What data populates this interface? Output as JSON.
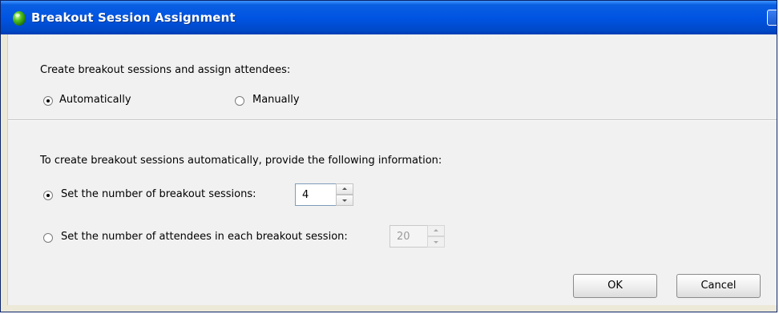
{
  "window": {
    "title": "Breakout Session Assignment"
  },
  "section_create": {
    "prompt": "Create breakout sessions and assign attendees:",
    "options": [
      {
        "label": "Automatically",
        "selected": true
      },
      {
        "label": "Manually",
        "selected": false
      }
    ]
  },
  "section_auto": {
    "prompt": "To create breakout sessions automatically, provide the following information:",
    "number_of_sessions": {
      "label": "Set the number of breakout sessions:",
      "selected": true,
      "value": "4"
    },
    "attendees_per_session": {
      "label": "Set the number of attendees in each breakout session:",
      "selected": false,
      "value": "20",
      "disabled": true
    }
  },
  "buttons": {
    "ok": "OK",
    "cancel": "Cancel"
  },
  "colors": {
    "titlebar": "#0054e3",
    "client_bg": "#f1f1f1"
  },
  "icons": {
    "title_icon": "green-orb-icon",
    "close": "close-icon"
  }
}
